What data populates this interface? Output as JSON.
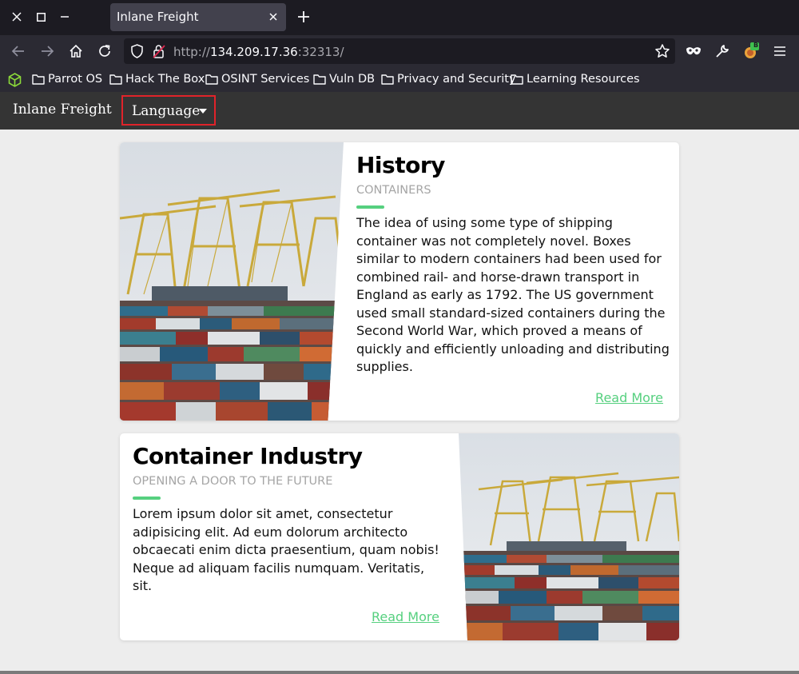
{
  "browser": {
    "tab_title": "Inlane Freight",
    "url_scheme": "http://",
    "url_host": "134.209.17.36",
    "url_rest": ":32313/",
    "extension_badge": "B"
  },
  "bookmarks": [
    {
      "label": "Parrot OS"
    },
    {
      "label": "Hack The Box"
    },
    {
      "label": "OSINT Services"
    },
    {
      "label": "Vuln DB"
    },
    {
      "label": "Privacy and Security"
    },
    {
      "label": "Learning Resources"
    }
  ],
  "site": {
    "brand": "Inlane Freight",
    "language_label": "Language"
  },
  "cards": [
    {
      "title": "History",
      "subtitle": "CONTAINERS",
      "text": "The idea of using some type of shipping container was not completely novel. Boxes similar to modern containers had been used for combined rail- and horse-drawn transport in England as early as 1792. The US government used small standard-sized containers during the Second World War, which proved a means of quickly and efficiently unloading and distributing supplies.",
      "link": "Read More"
    },
    {
      "title": "Container Industry",
      "subtitle": "OPENING A DOOR TO THE FUTURE",
      "text": "Lorem ipsum dolor sit amet, consectetur adipisicing elit. Ad eum dolorum architecto obcaecati enim dicta praesentium, quam nobis! Neque ad aliquam facilis numquam. Veritatis, sit.",
      "link": "Read More"
    }
  ],
  "colors": {
    "accent": "#56d07f",
    "nav_bg": "#343434",
    "highlight_border": "#e0232a"
  }
}
